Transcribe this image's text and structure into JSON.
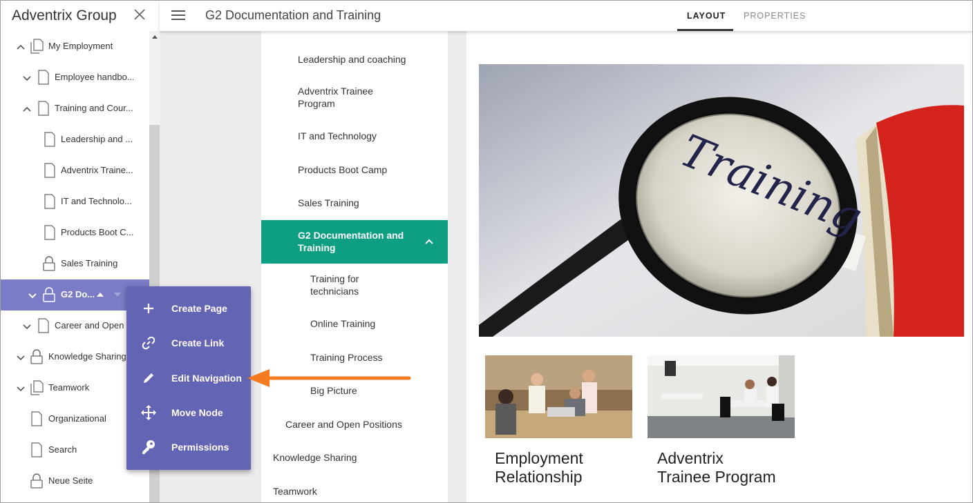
{
  "app": {
    "title": "Adventrix Group"
  },
  "topbar": {
    "page_title": "G2 Documentation and Training",
    "tabs": [
      {
        "label": "LAYOUT",
        "active": true
      },
      {
        "label": "PROPERTIES",
        "active": false
      }
    ]
  },
  "tree": {
    "items": [
      {
        "label": "My Employment",
        "icon": "pages-icon",
        "expanded": true
      },
      {
        "label": "Employee handbo...",
        "icon": "page-icon",
        "expanded": false
      },
      {
        "label": "Training and Cour...",
        "icon": "page-icon",
        "expanded": true
      },
      {
        "label": "Leadership and ...",
        "icon": "page-icon"
      },
      {
        "label": "Adventrix Traine...",
        "icon": "page-icon"
      },
      {
        "label": "IT and Technolo...",
        "icon": "page-icon"
      },
      {
        "label": "Products Boot C...",
        "icon": "page-icon"
      },
      {
        "label": "Sales Training",
        "icon": "lock-icon"
      },
      {
        "label": "G2 Do...",
        "icon": "lock-icon",
        "selected": true
      },
      {
        "label": "Career and Open ...",
        "icon": "page-icon",
        "expanded": false
      },
      {
        "label": "Knowledge Sharing",
        "icon": "lock-icon",
        "expanded": false
      },
      {
        "label": "Teamwork",
        "icon": "pages-icon",
        "expanded": false
      },
      {
        "label": "Organizational",
        "icon": "page-icon"
      },
      {
        "label": "Search",
        "icon": "page-icon"
      },
      {
        "label": "Neue Seite",
        "icon": "lock-icon"
      }
    ]
  },
  "context_menu": {
    "items": [
      {
        "label": "Create Page",
        "icon": "plus-icon"
      },
      {
        "label": "Create Link",
        "icon": "link-icon"
      },
      {
        "label": "Edit Navigation",
        "icon": "pencil-icon"
      },
      {
        "label": "Move Node",
        "icon": "move-icon"
      },
      {
        "label": "Permissions",
        "icon": "key-icon"
      }
    ]
  },
  "nav": {
    "items": [
      {
        "label": "Leadership and coaching"
      },
      {
        "label": "Adventrix Trainee Program"
      },
      {
        "label": "IT and Technology"
      },
      {
        "label": "Products Boot Camp"
      },
      {
        "label": "Sales Training"
      },
      {
        "label": "G2 Documentation and Training",
        "active": true
      },
      {
        "label": "Training for technicians"
      },
      {
        "label": "Online Training"
      },
      {
        "label": "Training Process"
      },
      {
        "label": "Big Picture"
      },
      {
        "label": "Career and Open Positions"
      },
      {
        "label": "Knowledge Sharing"
      },
      {
        "label": "Teamwork"
      }
    ]
  },
  "content": {
    "hero_word": "Training",
    "cards": [
      {
        "title_line1": "Employment",
        "title_line2": "Relationship"
      },
      {
        "title_line1": "Adventrix",
        "title_line2": "Trainee Program"
      }
    ]
  },
  "colors": {
    "accent_green": "#0e9f83",
    "menu_purple": "#6464b4",
    "selected_purple": "#7b7bc6",
    "arrow_orange": "#f47b20"
  }
}
